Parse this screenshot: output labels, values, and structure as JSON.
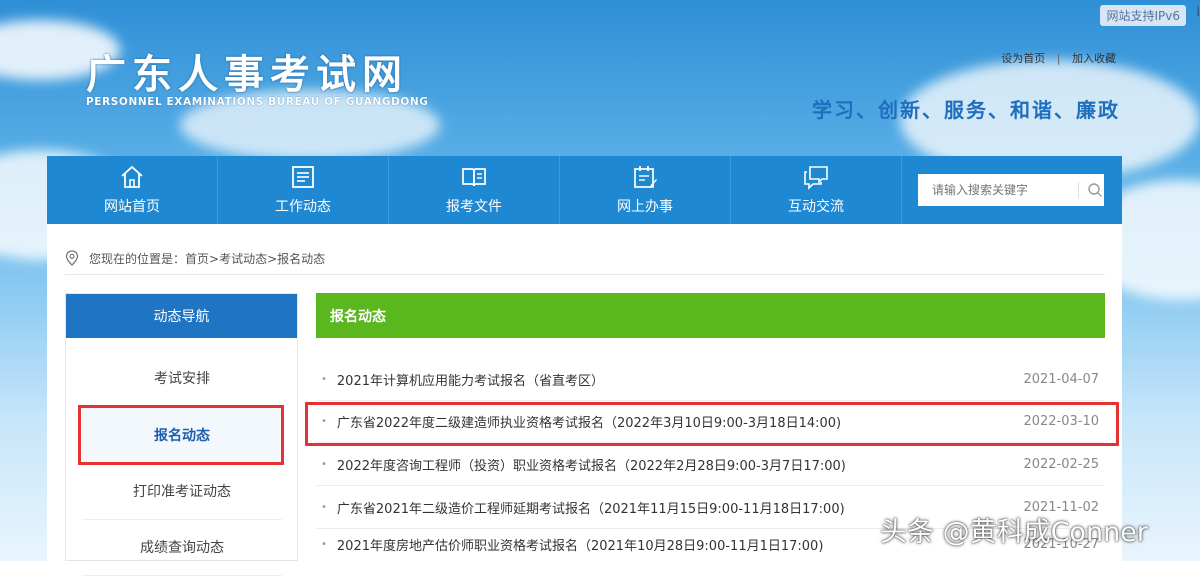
{
  "header": {
    "ipv6_badge": "网站支持IPv6",
    "ipv6_extra": "i",
    "logo_cn": "广东人事考试网",
    "logo_en": "PERSONNEL EXAMINATIONS BUREAU OF GUANGDONG",
    "set_home": "设为首页",
    "link_sep": "|",
    "add_favorite": "加入收藏",
    "slogan": "学习、创新、服务、和谐、廉政"
  },
  "nav": {
    "items": [
      {
        "label": "网站首页",
        "icon": "home-icon"
      },
      {
        "label": "工作动态",
        "icon": "news-icon"
      },
      {
        "label": "报考文件",
        "icon": "book-icon"
      },
      {
        "label": "网上办事",
        "icon": "calendar-pen-icon"
      },
      {
        "label": "互动交流",
        "icon": "chat-icon"
      }
    ],
    "search_placeholder": "请输入搜索关键字"
  },
  "breadcrumb": {
    "prefix": "您现在的位置是：",
    "path": "首页>考试动态>报名动态"
  },
  "sidebar": {
    "title": "动态导航",
    "items": [
      {
        "label": "考试安排",
        "active": false
      },
      {
        "label": "报名动态",
        "active": true
      },
      {
        "label": "打印准考证动态",
        "active": false
      },
      {
        "label": "成绩查询动态",
        "active": false
      }
    ]
  },
  "content": {
    "title": "报名动态",
    "news": [
      {
        "title": "2021年计算机应用能力考试报名（省直考区）",
        "date": "2021-04-07"
      },
      {
        "title": "广东省2022年度二级建造师执业资格考试报名（2022年3月10日9:00-3月18日14:00)",
        "date": "2022-03-10"
      },
      {
        "title": "2022年度咨询工程师（投资）职业资格考试报名（2022年2月28日9:00-3月7日17:00)",
        "date": "2022-02-25"
      },
      {
        "title": "广东省2021年二级造价工程师延期考试报名（2021年11月15日9:00-11月18日17:00)",
        "date": "2021-11-02"
      },
      {
        "title": "2021年度房地产估价师职业资格考试报名（2021年10月28日9:00-11月1日17:00)",
        "date": "2021-10-27"
      }
    ]
  },
  "watermark": "头条 @黄科成Conner",
  "colors": {
    "nav_blue": "#1f88d3",
    "sidebar_head": "#1f75c4",
    "content_head": "#5ab71d",
    "highlight_red": "#e53333"
  }
}
